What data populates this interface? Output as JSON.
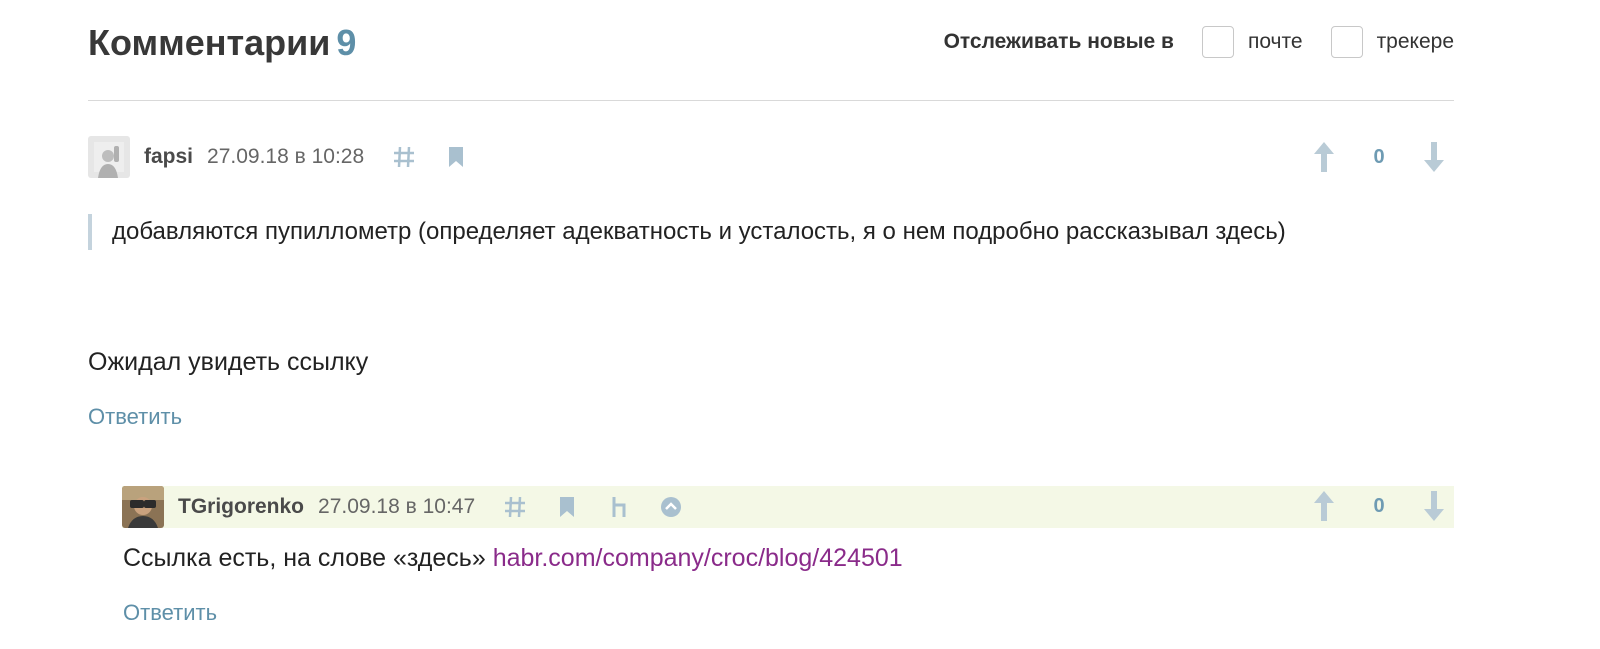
{
  "header": {
    "title": "Комментарии",
    "count": "9",
    "track_label": "Отслеживать новые в",
    "option_mail": "почте",
    "option_tracker": "трекере"
  },
  "comments": [
    {
      "author": "fapsi",
      "date": "27.09.18 в 10:28",
      "score": "0",
      "quote": "добавляются пупиллометр (определяет адекватность и усталость, я о нем подробно рассказывал здесь)",
      "text": "Ожидал увидеть ссылку",
      "reply_label": "Ответить",
      "icons": [
        "hash-icon",
        "bookmark-icon"
      ]
    },
    {
      "author": "TGrigorenko",
      "date": "27.09.18 в 10:47",
      "score": "0",
      "text": "Ссылка есть, на слове «здесь» ",
      "link": "habr.com/company/croc/blog/424501",
      "reply_label": "Ответить",
      "icons": [
        "hash-icon",
        "bookmark-icon",
        "parent-icon",
        "up-circle-icon"
      ]
    }
  ],
  "colors": {
    "accent": "#5e8fa8",
    "icon": "#a9c0cf",
    "link_visited": "#8a2b8a",
    "highlight": "#f4f8e6"
  }
}
